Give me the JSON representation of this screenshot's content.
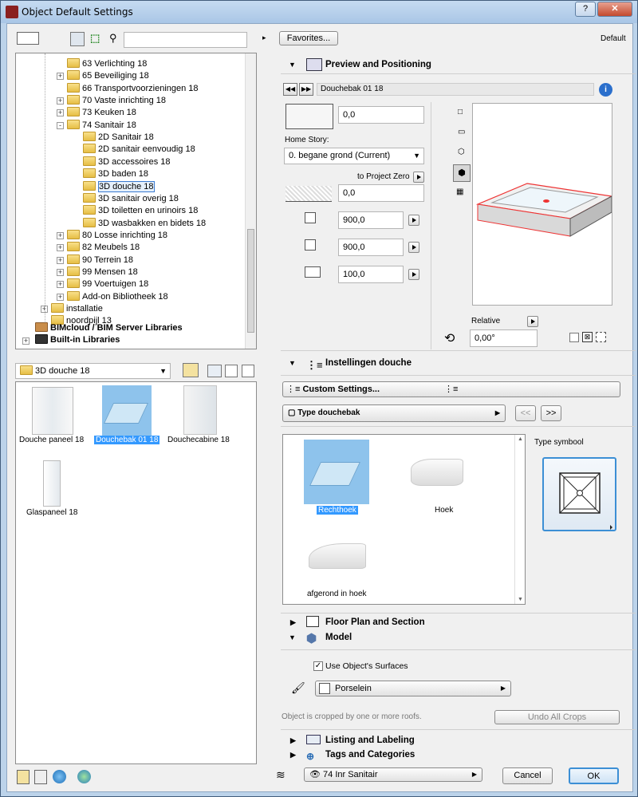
{
  "window": {
    "title": "Object Default Settings"
  },
  "left": {
    "tree": [
      {
        "label": "63 Verlichting 18",
        "indent": 2,
        "exp": false
      },
      {
        "label": "65 Beveiliging 18",
        "indent": 2,
        "exp": "+"
      },
      {
        "label": "66 Transportvoorzieningen 18",
        "indent": 2,
        "exp": false
      },
      {
        "label": "70 Vaste inrichting 18",
        "indent": 2,
        "exp": "+"
      },
      {
        "label": "73 Keuken 18",
        "indent": 2,
        "exp": "+"
      },
      {
        "label": "74 Sanitair 18",
        "indent": 2,
        "exp": "-"
      },
      {
        "label": "2D Sanitair 18",
        "indent": 3,
        "exp": false
      },
      {
        "label": "2D sanitair eenvoudig 18",
        "indent": 3,
        "exp": false
      },
      {
        "label": "3D accessoires 18",
        "indent": 3,
        "exp": false
      },
      {
        "label": "3D baden 18",
        "indent": 3,
        "exp": false
      },
      {
        "label": "3D douche 18",
        "indent": 3,
        "exp": false,
        "selected": true
      },
      {
        "label": "3D sanitair overig 18",
        "indent": 3,
        "exp": false
      },
      {
        "label": "3D toiletten en urinoirs 18",
        "indent": 3,
        "exp": false
      },
      {
        "label": "3D wasbakken en bidets 18",
        "indent": 3,
        "exp": false
      },
      {
        "label": "80 Losse inrichting 18",
        "indent": 2,
        "exp": "+"
      },
      {
        "label": "82 Meubels 18",
        "indent": 2,
        "exp": "+"
      },
      {
        "label": "90 Terrein 18",
        "indent": 2,
        "exp": "+"
      },
      {
        "label": "99 Mensen 18",
        "indent": 2,
        "exp": "+"
      },
      {
        "label": "99 Voertuigen 18",
        "indent": 2,
        "exp": "+"
      },
      {
        "label": "Add-on Bibliotheek 18",
        "indent": 2,
        "exp": "+"
      },
      {
        "label": "installatie",
        "indent": 1,
        "exp": "+"
      },
      {
        "label": "noordpijl 13",
        "indent": 1,
        "exp": false
      }
    ],
    "bimcloud": "BIMcloud / BIM Server Libraries",
    "builtin": "Built-in Libraries",
    "folder_select": "3D douche 18",
    "items": [
      {
        "label": "Douche paneel 18"
      },
      {
        "label": "Douchebak 01 18",
        "selected": true
      },
      {
        "label": "Douchecabine 18"
      },
      {
        "label": "Glaspaneel 18"
      }
    ]
  },
  "right": {
    "favorites": "Favorites...",
    "default": "Default",
    "preview_section": "Preview and Positioning",
    "object_name": "Douchebak 01 18",
    "elev_value": "0,0",
    "home_story_label": "Home Story:",
    "home_story_value": "0. begane grond (Current)",
    "project_zero": "to Project Zero",
    "zero_value": "0,0",
    "width_value": "900,0",
    "depth_value": "900,0",
    "height_value": "100,0",
    "relative_label": "Relative",
    "angle_value": "0,00°",
    "settings_section": "Instellingen douche",
    "custom_settings": "Custom Settings...",
    "type_label": "Type douchebak",
    "prev_btn": "<<",
    "next_btn": ">>",
    "type_items": [
      {
        "label": "Rechthoek",
        "selected": true
      },
      {
        "label": "Hoek"
      },
      {
        "label": "afgerond in hoek"
      }
    ],
    "type_symbol_label": "Type symbool",
    "floor_section": "Floor Plan and Section",
    "model_section": "Model",
    "use_surfaces": "Use Object's Surfaces",
    "surface": "Porselein",
    "cropped_text": "Object is cropped by one or more roofs.",
    "undo_crops": "Undo All Crops",
    "listing_section": "Listing and Labeling",
    "tags_section": "Tags and Categories",
    "layer": "74 Inr Sanitair",
    "cancel": "Cancel",
    "ok": "OK"
  }
}
